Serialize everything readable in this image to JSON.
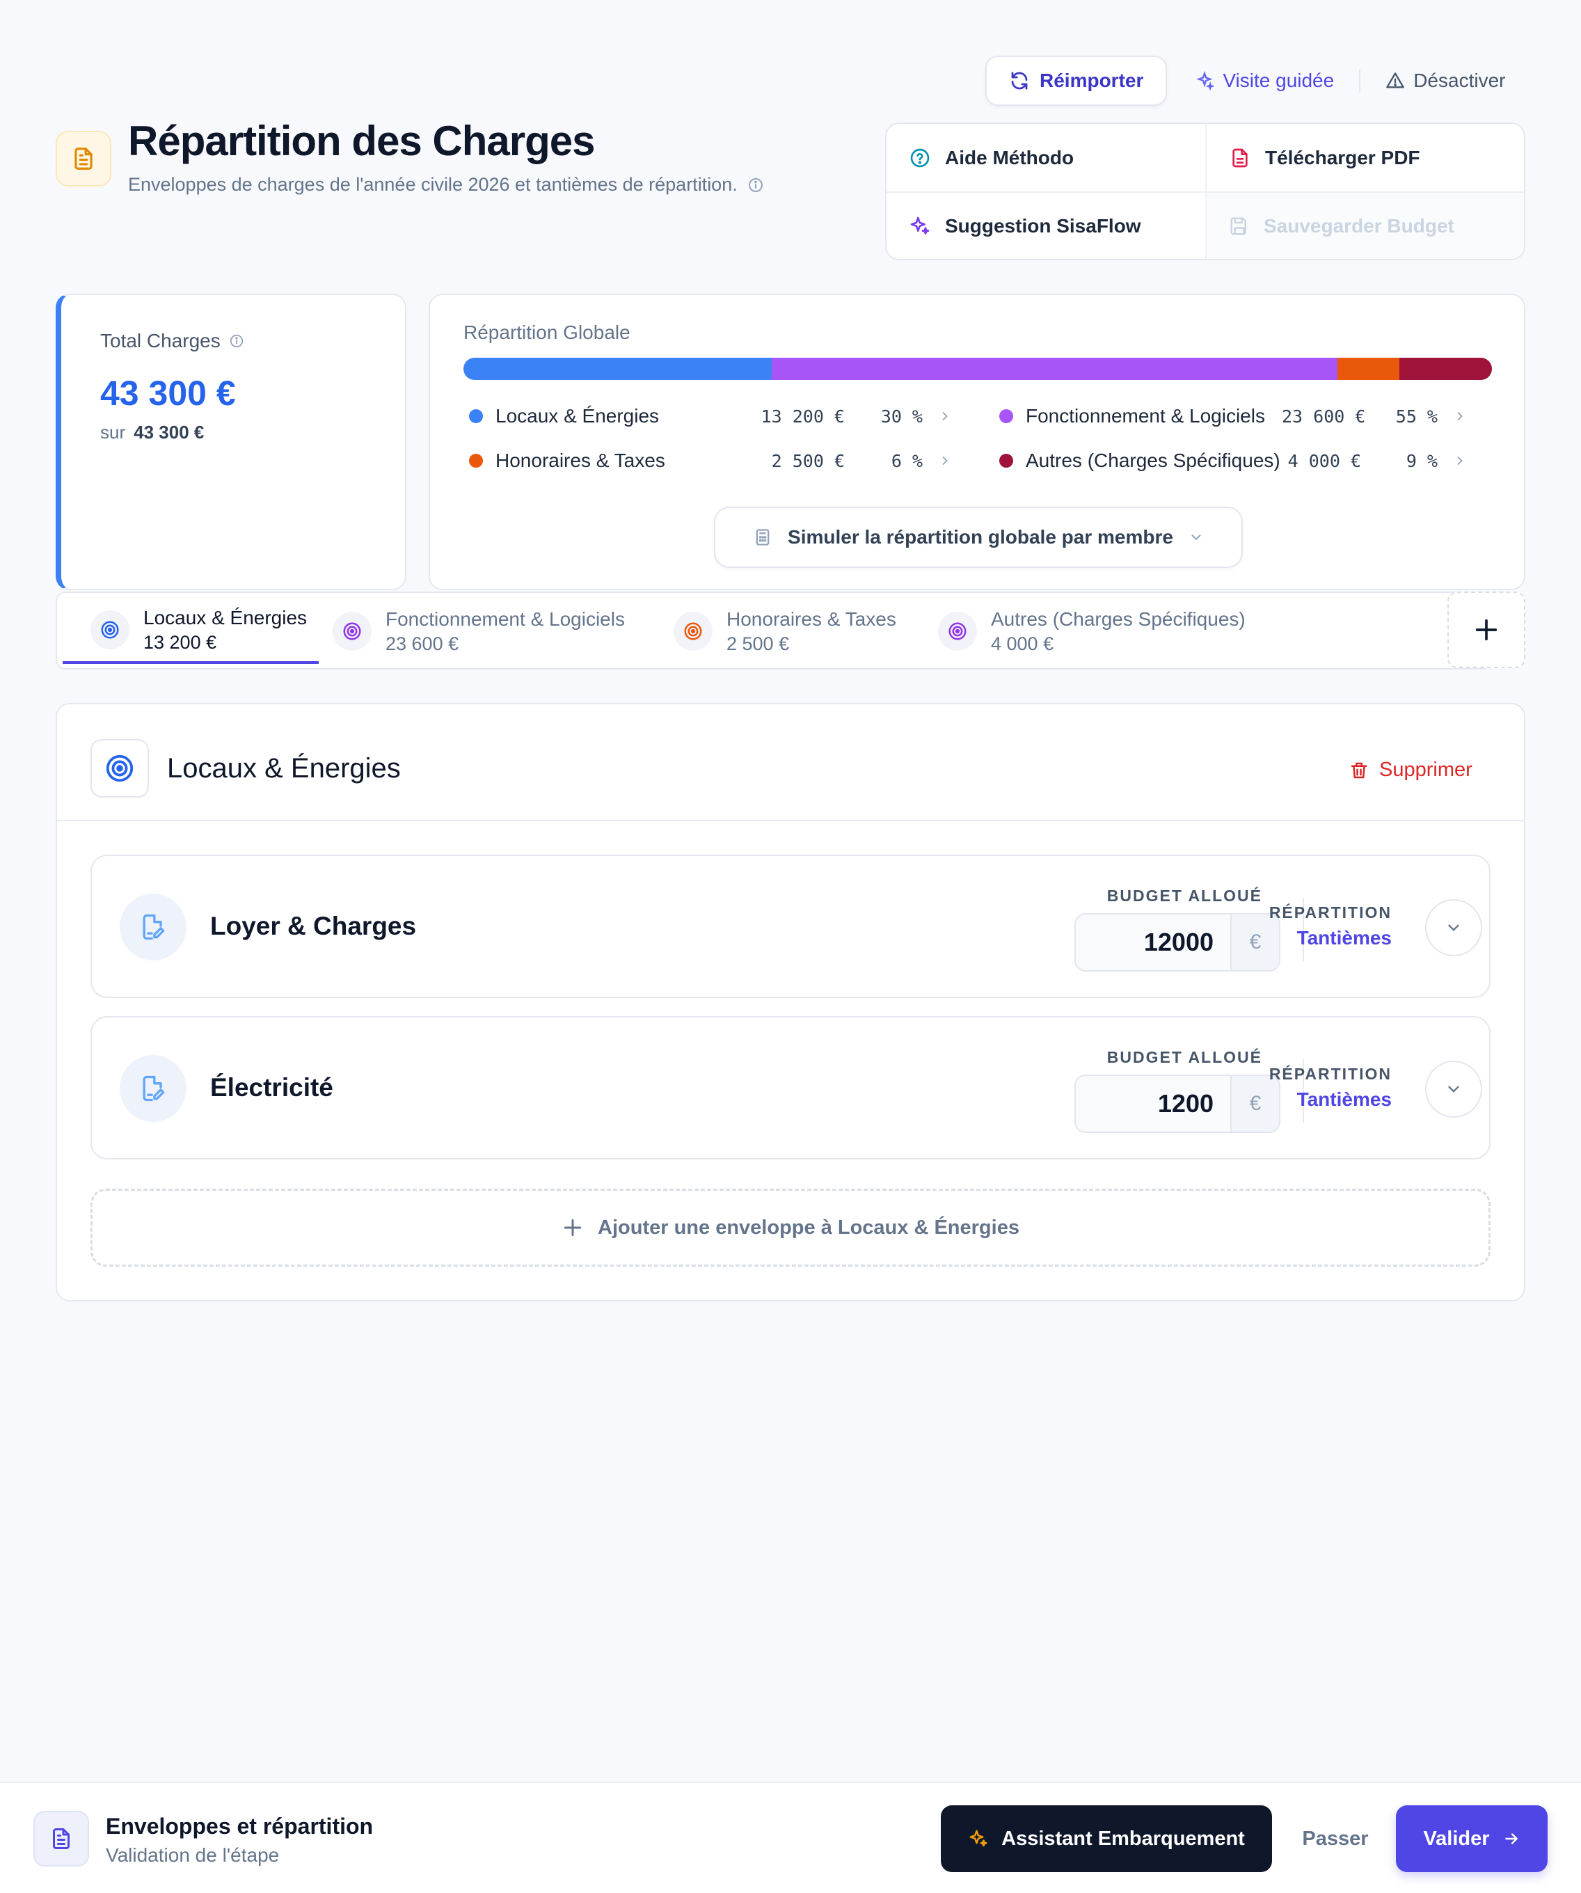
{
  "toolbar": {
    "reimporter": "Réimporter",
    "visite": "Visite guidée",
    "desactiver": "Désactiver"
  },
  "header": {
    "title": "Répartition des Charges",
    "subtitle": "Enveloppes de charges de l'année civile 2026 et tantièmes de répartition."
  },
  "actions": {
    "aide": "Aide Méthodo",
    "telecharger": "Télécharger PDF",
    "suggestion": "Suggestion SisaFlow",
    "sauvegarder": "Sauvegarder Budget"
  },
  "total": {
    "label": "Total Charges",
    "value": "43 300 €",
    "sub_prefix": "sur",
    "sub_value": "43 300 €"
  },
  "global": {
    "label": "Répartition Globale",
    "simulate": "Simuler la répartition globale par membre",
    "segments": [
      {
        "name": "Locaux & Énergies",
        "amount": "13 200 €",
        "pct": "30 %",
        "share": 30,
        "color": "#3b82f6"
      },
      {
        "name": "Fonctionnement & Logiciels",
        "amount": "23 600 €",
        "pct": "55 %",
        "share": 55,
        "color": "#a855f7"
      },
      {
        "name": "Honoraires & Taxes",
        "amount": "2 500 €",
        "pct": "6 %",
        "share": 6,
        "color": "#ea580c"
      },
      {
        "name": "Autres (Charges Spécifiques)",
        "amount": "4 000 €",
        "pct": "9 %",
        "share": 9,
        "color": "#9f1239"
      }
    ]
  },
  "tabs": [
    {
      "name": "Locaux & Énergies",
      "amount": "13 200 €"
    },
    {
      "name": "Fonctionnement & Logiciels",
      "amount": "23 600 €"
    },
    {
      "name": "Honoraires & Taxes",
      "amount": "2 500 €"
    },
    {
      "name": "Autres (Charges Spécifiques)",
      "amount": "4 000 €"
    }
  ],
  "panel": {
    "title": "Locaux & Énergies",
    "delete": "Supprimer",
    "budget_label": "BUDGET ALLOUÉ",
    "repartition_label": "RÉPARTITION",
    "currency": "€",
    "lines": [
      {
        "name": "Loyer & Charges",
        "budget": "12000",
        "repartition": "Tantièmes"
      },
      {
        "name": "Électricité",
        "budget": "1200",
        "repartition": "Tantièmes"
      }
    ],
    "add": "Ajouter une enveloppe à Locaux & Énergies"
  },
  "footer": {
    "title": "Enveloppes et répartition",
    "subtitle": "Validation de l'étape",
    "assistant": "Assistant Embarquement",
    "passer": "Passer",
    "valider": "Valider"
  },
  "colors": {
    "accent": "#4f46e5",
    "primary_blue": "#2563eb",
    "danger": "#dc2626"
  }
}
